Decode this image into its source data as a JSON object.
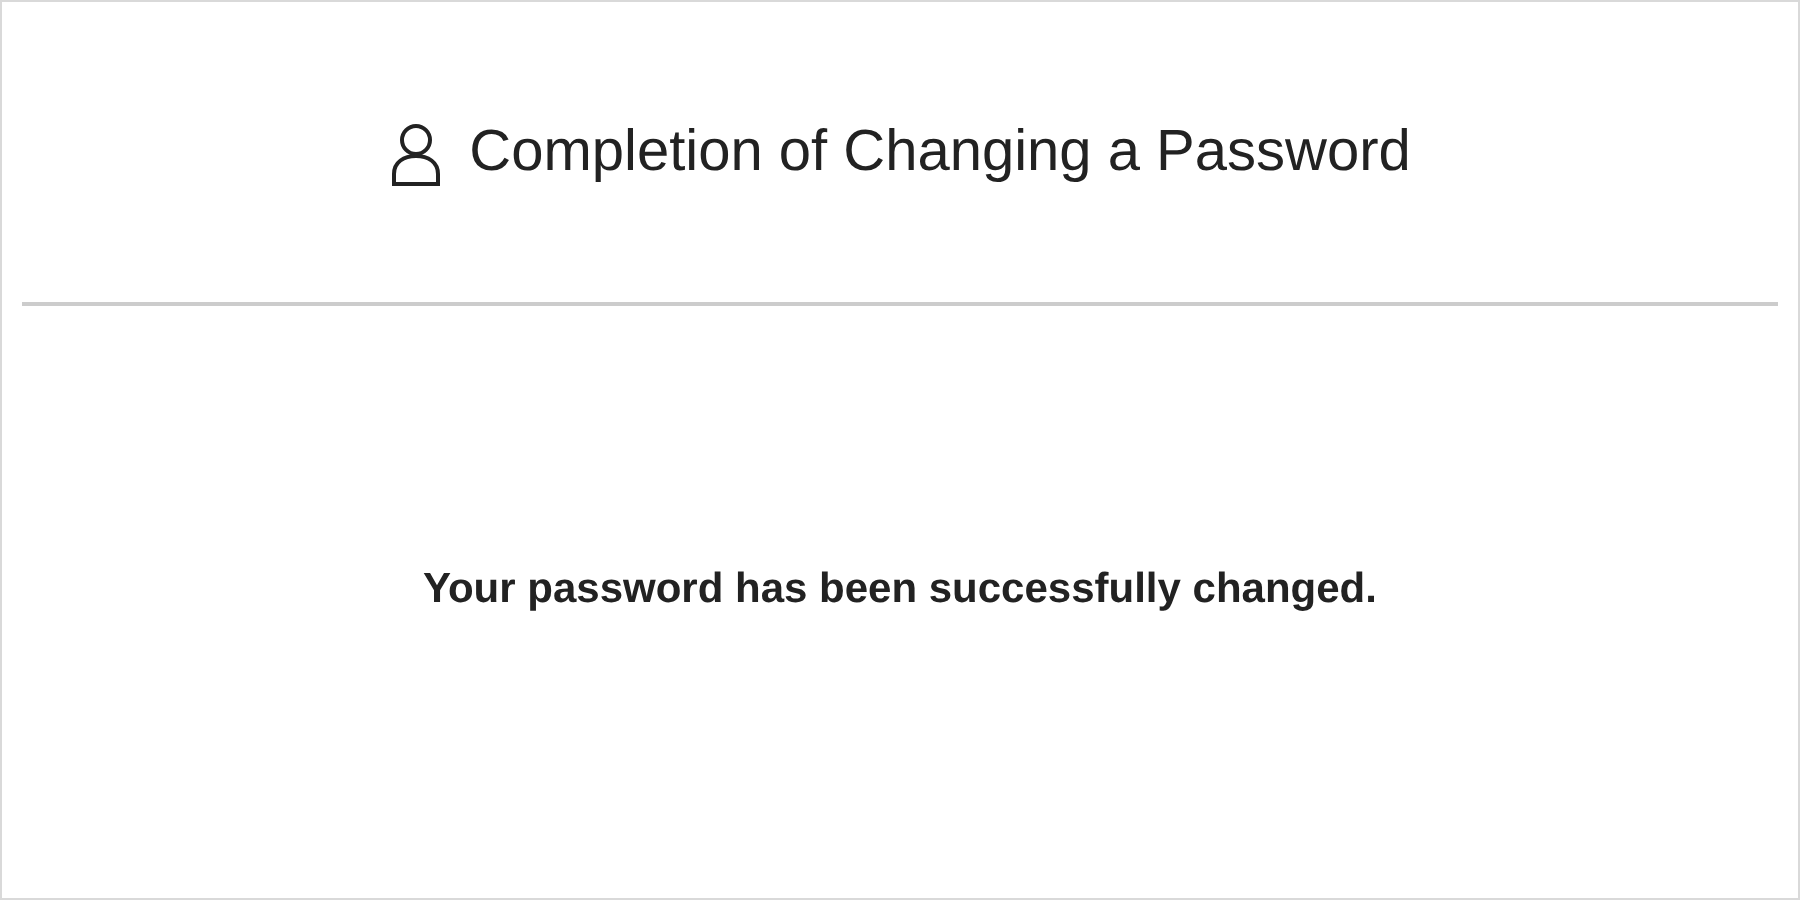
{
  "header": {
    "title": "Completion of Changing a Password"
  },
  "message": "Your password has been successfully changed."
}
